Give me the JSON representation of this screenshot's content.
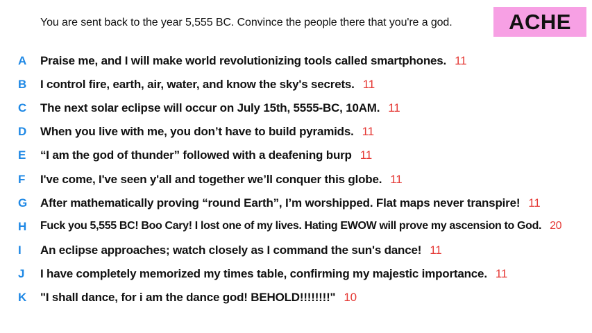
{
  "prompt": "You are sent back to the year 5,555 BC. Convince the people there that you're a god.",
  "badge": {
    "label": "ACHE",
    "background_color": "#F7A0E4"
  },
  "colors": {
    "letter": "#1E88E5",
    "text": "#111111",
    "score": "#E53935"
  },
  "answers": [
    {
      "letter": "A",
      "text": "Praise me, and I will make world revolutionizing tools called smartphones.",
      "score": "11"
    },
    {
      "letter": "B",
      "text": "I control fire, earth, air, water, and know the sky's secrets.",
      "score": "11"
    },
    {
      "letter": "C",
      "text": "The next solar eclipse will occur on July 15th, 5555-BC, 10AM.",
      "score": "11"
    },
    {
      "letter": "D",
      "text": "When you live with me, you don’t have to build pyramids.",
      "score": "11"
    },
    {
      "letter": "E",
      "text": "“I am the god of thunder” followed with a deafening burp",
      "score": "11"
    },
    {
      "letter": "F",
      "text": "I've come, I've seen y'all and together we’ll conquer this globe.",
      "score": "11"
    },
    {
      "letter": "G",
      "text": "After mathematically proving “round Earth”, I’m worshipped. Flat maps never transpire!",
      "score": "11"
    },
    {
      "letter": "H",
      "text": "Fuck you 5,555 BC! Boo Cary! I lost one of my lives. Hating EWOW will prove my ascension to God.",
      "score": "20"
    },
    {
      "letter": "I",
      "text": "An eclipse approaches; watch closely as I command the sun's dance!",
      "score": "11"
    },
    {
      "letter": "J",
      "text": "I have completely memorized my times table, confirming my majestic importance.",
      "score": "11"
    },
    {
      "letter": "K",
      "text": "\"I shall dance, for i am the dance god! BEHOLD!!!!!!!!\"",
      "score": "10"
    }
  ]
}
